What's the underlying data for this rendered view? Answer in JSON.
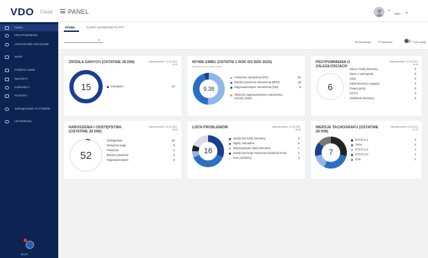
{
  "header": {
    "logo": "VDO",
    "logo_sub": "Fleet",
    "page_title": "PANEL",
    "user_top": "Hi",
    "user_name": "Hans"
  },
  "sidebar": {
    "items": [
      {
        "label": "PANEL",
        "icon": "dashboard-icon"
      },
      {
        "label": "PRZYPOMNIENIA",
        "icon": "bell-icon"
      },
      {
        "label": "ODSTĘPOWE SZKOLENIE",
        "icon": "clock-icon"
      },
      {
        "label": "MAPA",
        "icon": "map-icon"
      },
      {
        "label": "POBIERZ DANE",
        "icon": "download-icon"
      },
      {
        "label": "RAPORTY",
        "icon": "report-icon"
      },
      {
        "label": "KIEROWCY",
        "icon": "driver-icon"
      },
      {
        "label": "POJAZDY",
        "icon": "vehicle-icon"
      },
      {
        "label": "ZARZĄDZANIE SYSTEMEM",
        "icon": "users-icon"
      },
      {
        "label": "USTAWIENIA",
        "icon": "gear-icon"
      }
    ],
    "time": "20:23"
  },
  "tabs": [
    {
      "label": "PANEL"
    },
    {
      "label": "KARTA WYNIKÓW FLOTY"
    }
  ],
  "filters": {
    "stat1_value": "9",
    "stat1_label": "Kierowców",
    "stat2_value": "7",
    "stat2_label": "Pojazdów",
    "toggle_label": "Tryb edycji"
  },
  "cards": {
    "sources": {
      "title": "ŹRÓDŁA DANYCH (OSTATNIE 28 DNI)",
      "updated": "Zaktualizowane: 11.06.2024, 10:14",
      "center": "15",
      "items": [
        {
          "label": "Komputer",
          "value": "15"
        }
      ]
    },
    "ranking": {
      "title": "WYNIK EMBU (OSTATNI 1 ROK DO W20 2024)",
      "sub": "Aktualizowano co tydzień (W20)",
      "center": "9.38",
      "items": [
        {
          "label": "Poważne naruszenia (PN)",
          "value": "52"
        },
        {
          "label": "Bardzo poważne naruszenia (BPN)",
          "value": "45"
        },
        {
          "label": "Najpoważniejsze naruszenia (NN)",
          "value": "5"
        },
        {
          "label": "Wykryto najpoważniejsze naruszenia, ocenaj ryzyko",
          "value": ""
        }
      ]
    },
    "reminders": {
      "title": "PRZYPOMNIENIA O ZALEGŁOŚCIACH",
      "updated": "Zaktualizowane: 22.05.2024, 04:54",
      "center": "6",
      "items": [
        {
          "label": "Dane z karty kierowcy",
          "value": "5"
        },
        {
          "label": "Dane z tachografu",
          "value": "0"
        },
        {
          "label": "VDO",
          "value": "0"
        },
        {
          "label": "Karta kierowcy wygasa",
          "value": "0"
        },
        {
          "label": "Prawo jazdy",
          "value": "0"
        },
        {
          "label": "DTCO",
          "value": "0"
        },
        {
          "label": "Szkolenie kierowcy",
          "value": "0"
        }
      ]
    },
    "violations": {
      "title": "NARUSZENIA I ODSTĘPSTWA (OSTATNIE 28 DNI)",
      "updated": "Zaktualizowane: 22.05.2024, 04:54",
      "center": "52",
      "items": [
        {
          "label": "Odstępstwa",
          "value": "40"
        },
        {
          "label": "Mniejszej wagi",
          "value": "5"
        },
        {
          "label": "Poważne",
          "value": "1"
        },
        {
          "label": "Bardzo poważne",
          "value": "2"
        },
        {
          "label": "Najpoważniejsze",
          "value": "3"
        }
      ]
    },
    "problems": {
      "title": "LISTA PROBLEMÓW",
      "updated": "Zaktualizowane: 22.05.2024, 04:54",
      "center": "16",
      "items": [
        {
          "label": "Jazda bez karty kierowcy",
          "value": "5"
        },
        {
          "label": "Wpisy manualne",
          "value": "6"
        },
        {
          "label": "Nieprzypisane karty kierowcy",
          "value": "1"
        },
        {
          "label": "Jazda bez kraju rozpoczęcia/zakończenia",
          "value": "1"
        },
        {
          "label": "Inne problemy",
          "value": "3"
        }
      ]
    },
    "tacho": {
      "title": "WERSJE TACHOGRAFU (OSTATNIE 28 DNI)",
      "updated": "Zaktualizowane: 8.06.2024, 10:13",
      "center": "7",
      "items": [
        {
          "label": "DTCO 2.1",
          "value": "2"
        },
        {
          "label": "*Inne",
          "value": "2"
        },
        {
          "label": "DTCO 2.2",
          "value": "1"
        },
        {
          "label": "DTCO 4.0",
          "value": "1"
        },
        {
          "label": "Inne",
          "value": "1"
        }
      ]
    }
  },
  "colors": {
    "navy": "#0d2352",
    "blue_dark": "#1a3f8f",
    "blue": "#2c6fc2",
    "blue_light": "#8fb6e8",
    "orange": "#f08a24",
    "gray_ring": "#d9dde3",
    "black": "#222222"
  },
  "donut_values": {
    "sources": [
      15
    ],
    "ranking": [
      52,
      45,
      5
    ],
    "violations": [
      1
    ],
    "problems": [
      5,
      6,
      1,
      1,
      3
    ],
    "tacho": [
      2,
      2,
      1,
      1,
      1
    ]
  }
}
